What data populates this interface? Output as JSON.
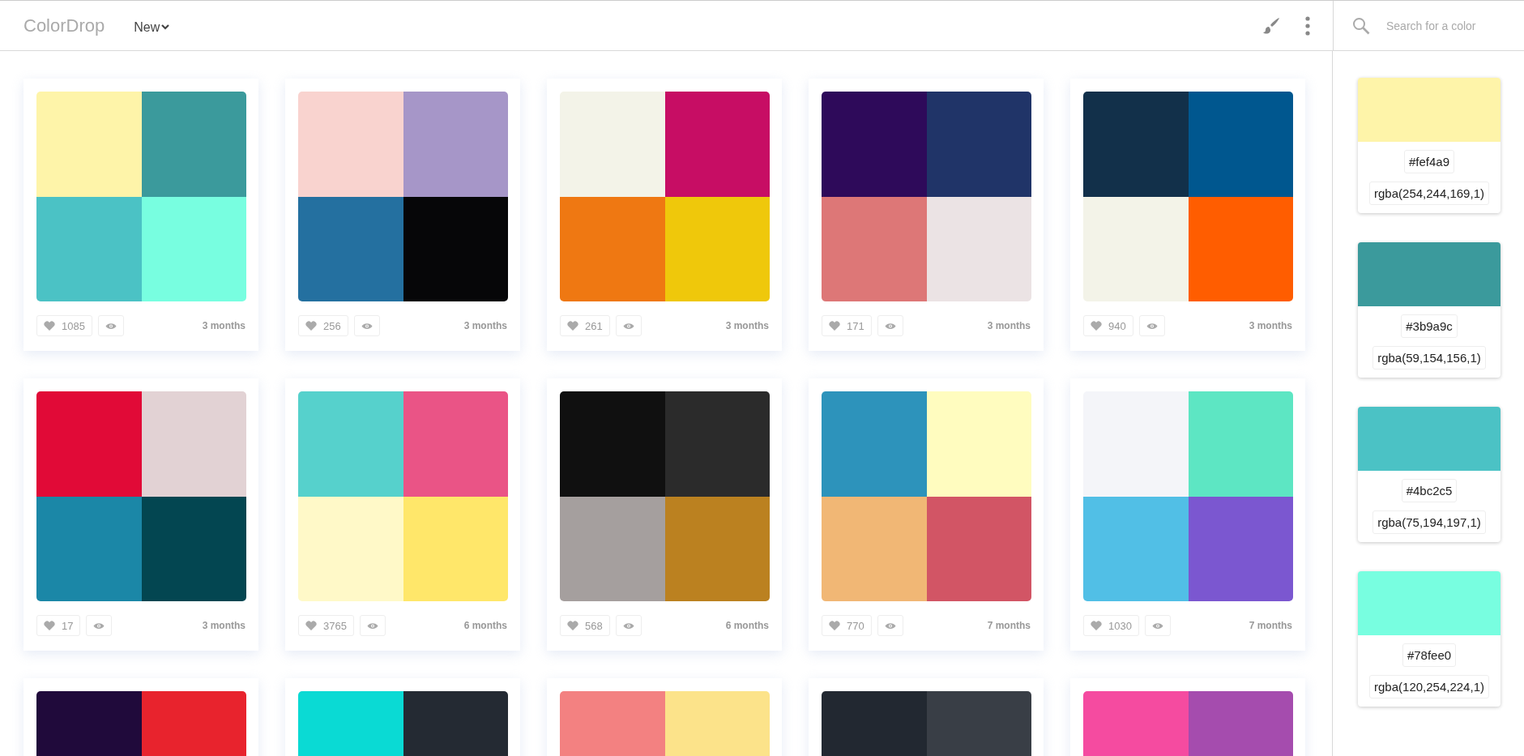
{
  "header": {
    "logo": "ColorDrop",
    "menu": "New",
    "search": {
      "placeholder": "Search for a color"
    }
  },
  "palettes": [
    {
      "colors": [
        {
          "color": "#fef4a9"
        },
        {
          "color": "#3b9a9c"
        },
        {
          "color": "#4bc2c5"
        },
        {
          "color": "#78fee0"
        }
      ],
      "likes": "1085",
      "age": "3 months"
    },
    {
      "colors": [
        {
          "color": "#f9d3cf"
        },
        {
          "color": "#a696c8"
        },
        {
          "color": "#2470a0"
        },
        {
          "color": "#060608"
        }
      ],
      "likes": "256",
      "age": "3 months"
    },
    {
      "colors": [
        {
          "color": "#f3f3e8"
        },
        {
          "color": "#c70d64"
        },
        {
          "color": "#ef7812"
        },
        {
          "color": "#efc80b"
        }
      ],
      "likes": "261",
      "age": "3 months"
    },
    {
      "colors": [
        {
          "color": "#2e0a5a"
        },
        {
          "color": "#203468"
        },
        {
          "color": "#dd7777"
        },
        {
          "color": "#ebe3e4"
        }
      ],
      "likes": "171",
      "age": "3 months"
    },
    {
      "colors": [
        {
          "color": "#12304a"
        },
        {
          "color": "#00578f"
        },
        {
          "color": "#f3f3e8"
        },
        {
          "color": "#ff5d00"
        }
      ],
      "likes": "940",
      "age": "3 months"
    },
    {
      "colors": [
        {
          "color": "#e10a37"
        },
        {
          "color": "#e2d2d4"
        },
        {
          "color": "#1b87a7"
        },
        {
          "color": "#034651"
        }
      ],
      "likes": "17",
      "age": "3 months"
    },
    {
      "colors": [
        {
          "color": "#56d1cc"
        },
        {
          "color": "#ea5486"
        },
        {
          "color": "#fff9c8"
        },
        {
          "color": "#ffe76a"
        }
      ],
      "likes": "3765",
      "age": "6 months"
    },
    {
      "colors": [
        {
          "color": "#101010"
        },
        {
          "color": "#2b2b2b"
        },
        {
          "color": "#a59f9e"
        },
        {
          "color": "#bb8120"
        }
      ],
      "likes": "568",
      "age": "6 months"
    },
    {
      "colors": [
        {
          "color": "#2d93bb"
        },
        {
          "color": "#fffcbf"
        },
        {
          "color": "#f1b775"
        },
        {
          "color": "#d25565"
        }
      ],
      "likes": "770",
      "age": "7 months"
    },
    {
      "colors": [
        {
          "color": "#f4f5f9"
        },
        {
          "color": "#5de6c3"
        },
        {
          "color": "#51bfe6"
        },
        {
          "color": "#7b57d0"
        }
      ],
      "likes": "1030",
      "age": "7 months"
    },
    {
      "colors": [
        {
          "color": "#200a3b"
        },
        {
          "color": "#e8232d"
        }
      ]
    },
    {
      "colors": [
        {
          "color": "#0adad4"
        },
        {
          "color": "#242a33"
        }
      ]
    },
    {
      "colors": [
        {
          "color": "#f38181"
        },
        {
          "color": "#fce38a"
        }
      ]
    },
    {
      "colors": [
        {
          "color": "#222831"
        },
        {
          "color": "#393e46"
        }
      ]
    },
    {
      "colors": [
        {
          "color": "#f54ba0"
        },
        {
          "color": "#a54cae"
        }
      ]
    }
  ],
  "sidebar": [
    {
      "color": "#fef4a9",
      "hex": "#fef4a9",
      "rgba": "rgba(254,244,169,1)"
    },
    {
      "color": "#3b9a9c",
      "hex": "#3b9a9c",
      "rgba": "rgba(59,154,156,1)"
    },
    {
      "color": "#4bc2c5",
      "hex": "#4bc2c5",
      "rgba": "rgba(75,194,197,1)"
    },
    {
      "color": "#78fee0",
      "hex": "#78fee0",
      "rgba": "rgba(120,254,224,1)"
    }
  ]
}
